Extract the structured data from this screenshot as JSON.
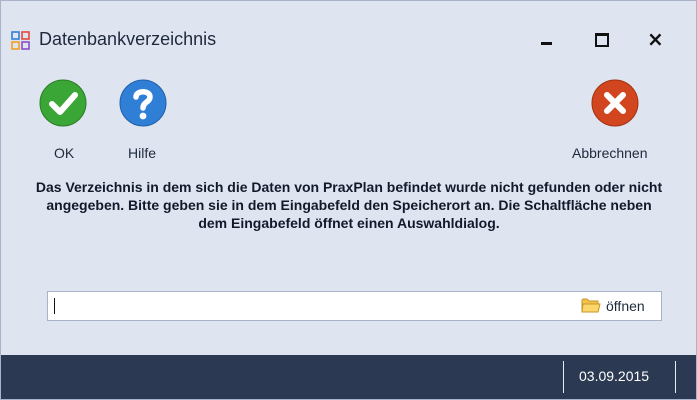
{
  "window": {
    "title": "Datenbankverzeichnis",
    "minimize_icon": "minimize-icon",
    "maximize_icon": "maximize-icon",
    "close_label": "×"
  },
  "toolbar": {
    "ok_label": "OK",
    "help_label": "Hilfe",
    "cancel_label": "Abbrechnen"
  },
  "message": "Das Verzeichnis in dem sich die Daten von PraxPlan befindet wurde nicht gefunden oder nicht angegeben.  Bitte geben sie in dem Eingabefeld den Speicherort an.  Die Schaltfläche neben dem Eingabefeld öffnet einen Auswahldialog.",
  "path_field": {
    "value": "",
    "open_label": "öffnen"
  },
  "statusbar": {
    "date": "03.09.2015"
  },
  "colors": {
    "window_bg": "#dfe4f1",
    "statusbar_bg": "#2b3a52",
    "ok_green": "#3aa635",
    "help_blue": "#2f7fd6",
    "cancel_red": "#d1451f"
  }
}
